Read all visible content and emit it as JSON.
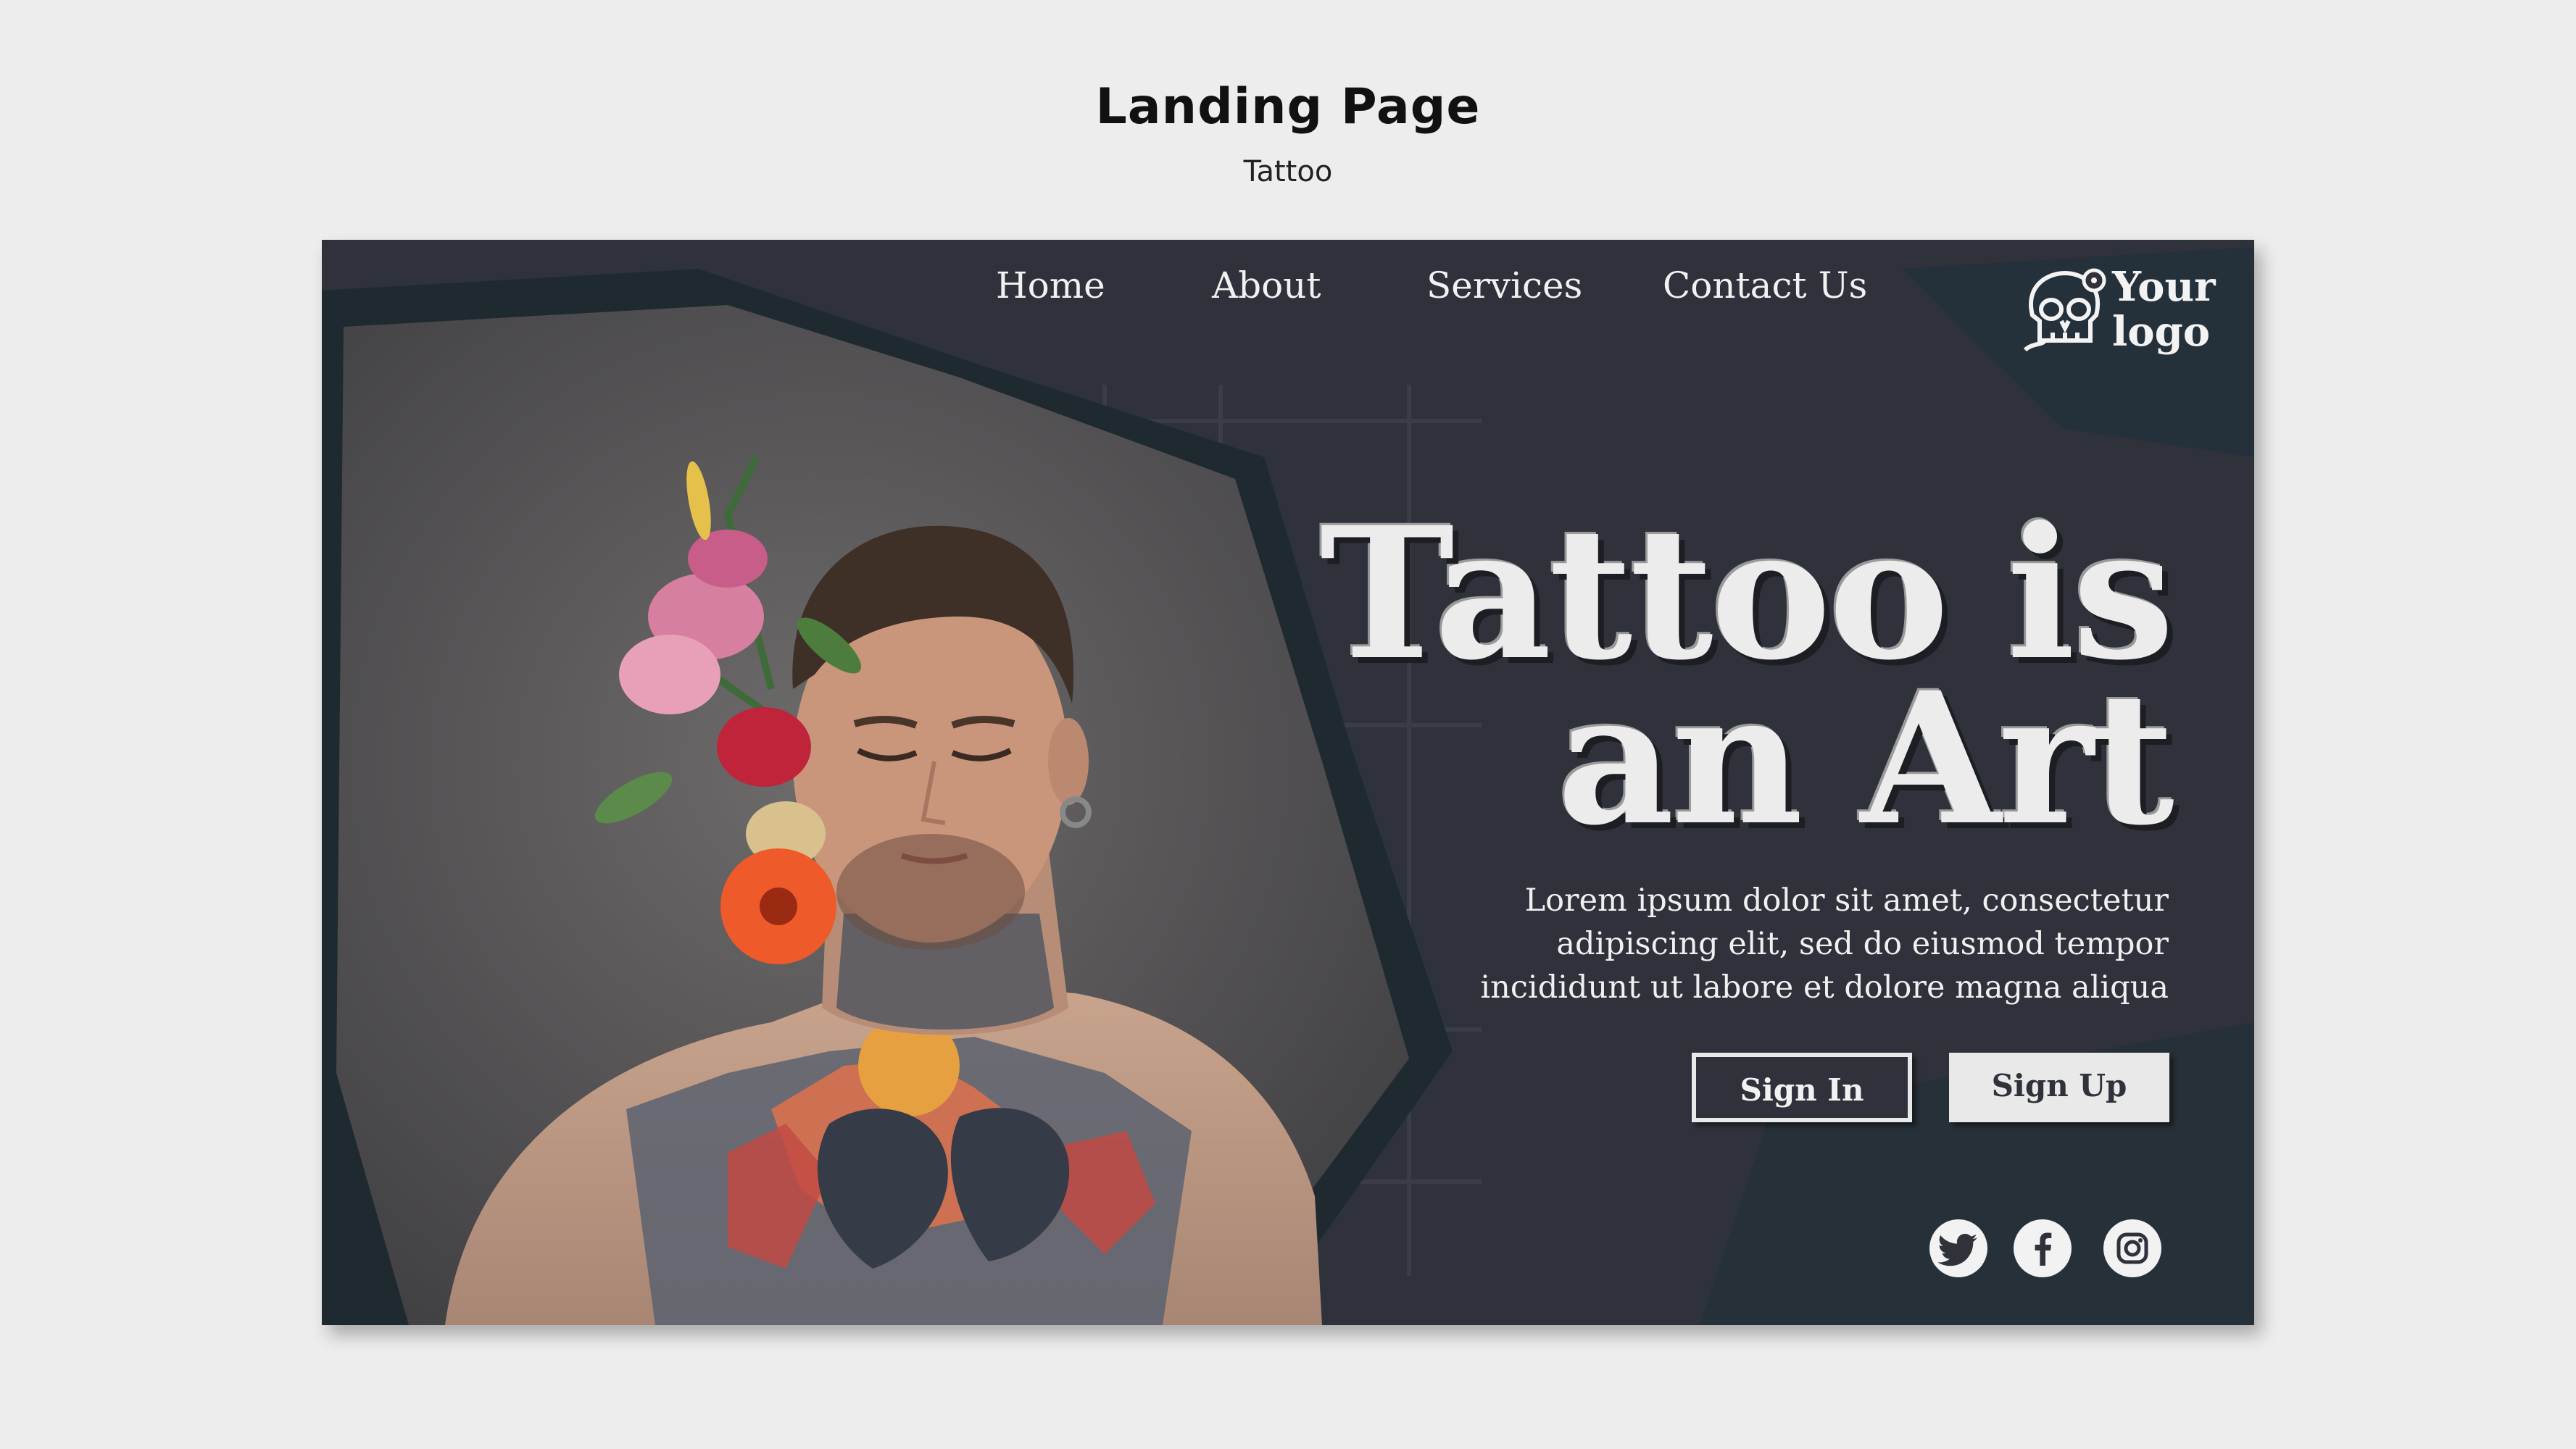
{
  "page": {
    "title": "Landing Page",
    "subtitle": "Tattoo"
  },
  "nav": {
    "items": [
      {
        "label": "Home"
      },
      {
        "label": "About"
      },
      {
        "label": "Services"
      },
      {
        "label": "Contact Us"
      }
    ]
  },
  "logo": {
    "line1": "Your",
    "line2": "logo",
    "icon": "skull-icon"
  },
  "hero": {
    "title_line1": "Tattoo is",
    "title_line2": "an Art",
    "body_line1": "Lorem ipsum dolor sit amet, consectetur",
    "body_line2": "adipiscing elit, sed do eiusmod tempor",
    "body_line3": "incididunt ut labore et dolore magna aliqua",
    "image": "tattooed-man-with-flowers"
  },
  "buttons": {
    "sign_in": "Sign In",
    "sign_up": "Sign Up"
  },
  "social": [
    {
      "icon": "twitter-icon"
    },
    {
      "icon": "facebook-icon"
    },
    {
      "icon": "instagram-icon"
    }
  ],
  "colors": {
    "panel": "#2f323b",
    "background": "#ededed",
    "text_light": "#ececec",
    "brush": "#1f2a30"
  }
}
